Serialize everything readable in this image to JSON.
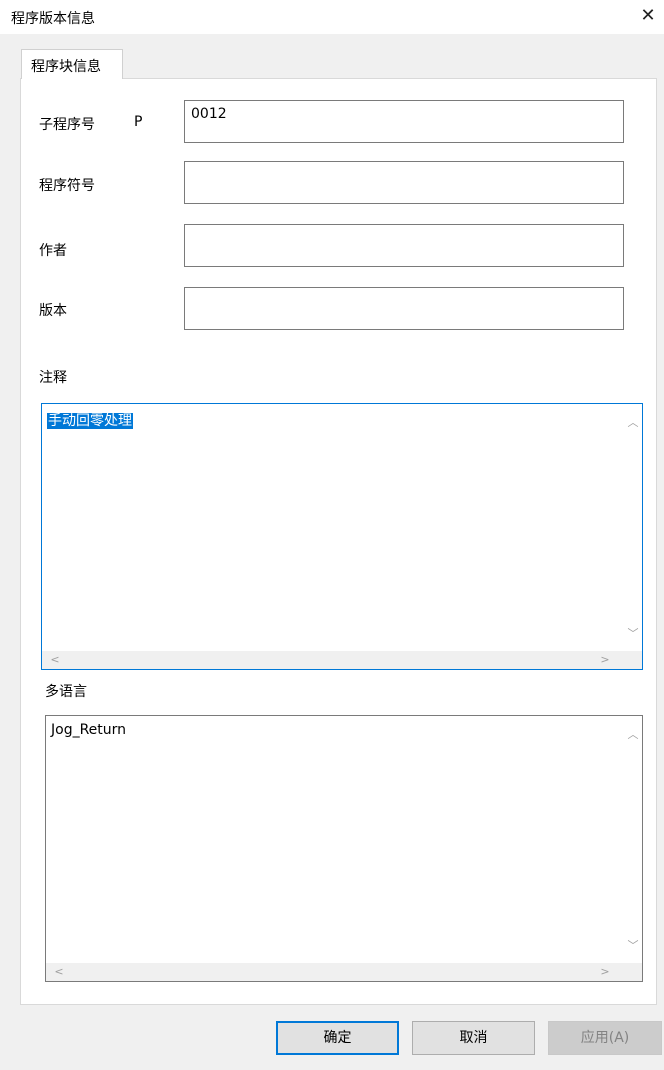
{
  "window": {
    "title": "程序版本信息",
    "close_glyph": "✕"
  },
  "tabs": [
    {
      "label": "程序块信息",
      "active": true
    }
  ],
  "form": {
    "subprogram_label": "子程序号",
    "subprogram_prefix": "P",
    "subprogram_value": "0012",
    "symbol_label": "程序符号",
    "symbol_value": "",
    "author_label": "作者",
    "author_value": "",
    "version_label": "版本",
    "version_value": ""
  },
  "comment": {
    "label": "注释",
    "text": "手动回零处理"
  },
  "multilang": {
    "label": "多语言",
    "text": "Jog_Return"
  },
  "scroll_glyphs": {
    "up": "︿",
    "down": "﹀",
    "left": "<",
    "right": ">"
  },
  "buttons": {
    "ok": "确定",
    "cancel": "取消",
    "apply": "应用(A)"
  },
  "colors": {
    "accent": "#0078d7",
    "window_bg": "#f0f0f0",
    "disabled_text": "#838383"
  }
}
